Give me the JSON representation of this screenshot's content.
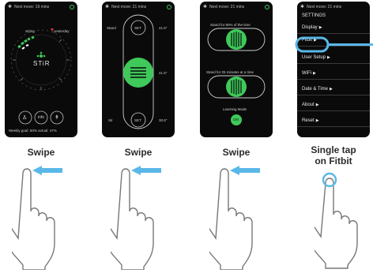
{
  "screens": [
    {
      "status": "Next move: 19 mins",
      "dial_top_left": "sitting",
      "dial_top_right": "yesterday",
      "logo": "STiR",
      "bottom_buttons": [
        "info"
      ],
      "footer": "Weekly goal: 50% actual: 47%"
    },
    {
      "status": "Next move: 21 mins",
      "stand_label": "Stand",
      "stand_button": "SET",
      "stand_height": "41.6\"",
      "mid_height": "41.6\"",
      "sit_label": "Sit",
      "sit_button": "SET",
      "sit_height": "30.6\""
    },
    {
      "status": "Next move: 21 mins",
      "stand_pct_label": "Stand for 60% of the time",
      "stand_min_label": "Stand for 25 minutes at a time",
      "learning_label": "Learning Mode",
      "learning_button": "ON"
    },
    {
      "status": "Next move: 21 mins",
      "title": "SETTINGS",
      "items": [
        "Display",
        "Fitbit",
        "User Setup",
        "WiFi",
        "Date & Time",
        "About",
        "Reset"
      ]
    }
  ],
  "captions": [
    "Swipe",
    "Swipe",
    "Swipe",
    "Single tap\non Fitbit"
  ],
  "colors": {
    "accent_green": "#3ec95a",
    "arrow_blue": "#5ab8e8",
    "phone_bg": "#0a0a0a"
  },
  "icons": [
    "gear-icon",
    "person-icon",
    "info-icon",
    "stand-icon",
    "hand-icon",
    "arrow-left-icon",
    "tap-ring-icon"
  ]
}
